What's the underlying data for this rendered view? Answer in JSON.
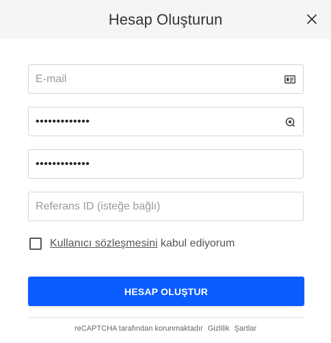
{
  "header": {
    "title": "Hesap Oluşturun",
    "close_icon": "close-icon"
  },
  "form": {
    "email": {
      "placeholder": "E-mail",
      "value": "",
      "icon": "id-card-icon"
    },
    "password": {
      "value": "•••••••••••••",
      "icon": "eye-icon"
    },
    "password_confirm": {
      "value": "•••••••••••••"
    },
    "referral": {
      "placeholder": "Referans ID (isteğe bağlı)",
      "value": ""
    },
    "agree": {
      "checked": false,
      "link_text": "Kullanıcı sözleşmesini",
      "text": "kabul ediyorum"
    },
    "submit_label": "HESAP OLUŞTUR"
  },
  "footer": {
    "recaptcha_text": "reCAPTCHA tarafından korunmaktadır",
    "privacy_link": "Gizlilik",
    "terms_link": "Şartlar"
  },
  "colors": {
    "primary": "#0a5cff",
    "header_bg": "#f5f5f5",
    "border": "#d4d4d4"
  }
}
